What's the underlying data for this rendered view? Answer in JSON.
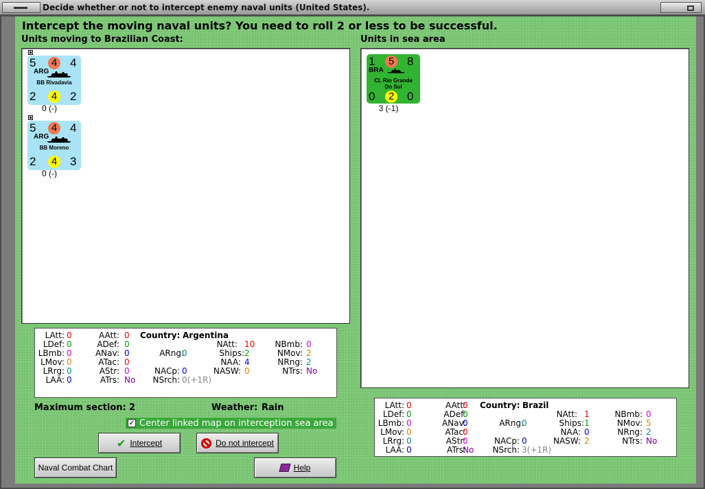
{
  "window": {
    "title": "Decide whether or not to intercept enemy naval units (United States)."
  },
  "prompt": "Intercept the moving naval units?  You need to roll 2 or less to be successful.",
  "left_heading": "Units moving to Brazilian Coast:",
  "right_heading": "Units in sea area",
  "moving_units": [
    {
      "tl": "5",
      "tc": "4",
      "tr": "4",
      "nat": "ARG",
      "name": "BB Rivadavia",
      "bl": "2",
      "bc": "4",
      "br": "2",
      "caption": "0 (-)"
    },
    {
      "tl": "5",
      "tc": "4",
      "tr": "4",
      "nat": "ARG",
      "name": "BB Moreno",
      "bl": "2",
      "bc": "4",
      "br": "3",
      "caption": "0 (-)"
    }
  ],
  "sea_units": [
    {
      "tl": "1",
      "tc": "5",
      "tr": "8",
      "nat": "BRA",
      "name1": "CL Rio Grande",
      "name2": "Do Sul",
      "bl": "0",
      "bc": "2",
      "br": "0",
      "caption": "3 (-1)"
    }
  ],
  "left_stats": {
    "country_label": "Country:",
    "country": "Argentina",
    "LAtt": "0",
    "LDef": "0",
    "LBmb": "0",
    "LMov": "0",
    "LRrg": "0",
    "LAA": "0",
    "AAtt": "0",
    "ADef": "0",
    "ANav": "0",
    "ATac": "0",
    "AStr": "0",
    "ATrs": "No",
    "ARng": "0",
    "NACp": "0",
    "NSrch": "0(+1R)",
    "NAtt": "10",
    "Ships": "2",
    "NAA": "4",
    "NASW": "0",
    "NBmb": "0",
    "NMov": "2",
    "NRng": "2",
    "NTrs": "No"
  },
  "right_stats": {
    "country_label": "Country:",
    "country": "Brazil",
    "LAtt": "0",
    "LDef": "0",
    "LBmb": "0",
    "LMov": "0",
    "LRrg": "0",
    "LAA": "0",
    "AAtt": "0",
    "ADef": "0",
    "ANav": "0",
    "ATac": "0",
    "AStr": "0",
    "ATrs": "No",
    "ARng": "0",
    "NACp": "0",
    "NSrch": "3(+1R)",
    "NAtt": "1",
    "Ships": "1",
    "NAA": "0",
    "NASW": "2",
    "NBmb": "0",
    "NMov": "5",
    "NRng": "2",
    "NTrs": "No"
  },
  "labels": {
    "LAtt": "LAtt:",
    "LDef": "LDef:",
    "LBmb": "LBmb:",
    "LMov": "LMov:",
    "LRrg": "LRrg:",
    "LAA": "LAA:",
    "AAtt": "AAtt:",
    "ADef": "ADef:",
    "ANav": "ANav:",
    "ATac": "ATac:",
    "AStr": "AStr:",
    "ATrs": "ATrs:",
    "ARng": "ARng:",
    "NACp": "NACp:",
    "NSrch": "NSrch:",
    "NAtt": "NAtt:",
    "Ships": "Ships:",
    "NAA": "NAA:",
    "NASW": "NASW:",
    "NBmb": "NBmb:",
    "NMov": "NMov:",
    "NRng": "NRng:",
    "NTrs": "NTrs:"
  },
  "max_section_label": "Maximum section:",
  "max_section": "2",
  "weather_label": "Weather:",
  "weather": "Rain",
  "center_checkbox": {
    "label": "Center linked map on interception sea area",
    "checked": true
  },
  "buttons": {
    "intercept": "Intercept",
    "do_not_intercept": "Do not intercept",
    "naval_combat_chart": "Naval Combat Chart",
    "help": "Help"
  },
  "colors": {
    "panel_green": "#7ec878",
    "counter_arg": "#a9e3f5",
    "counter_bra": "#32b432",
    "circle_orange": "#f07850",
    "circle_yellow": "#ffff00"
  }
}
